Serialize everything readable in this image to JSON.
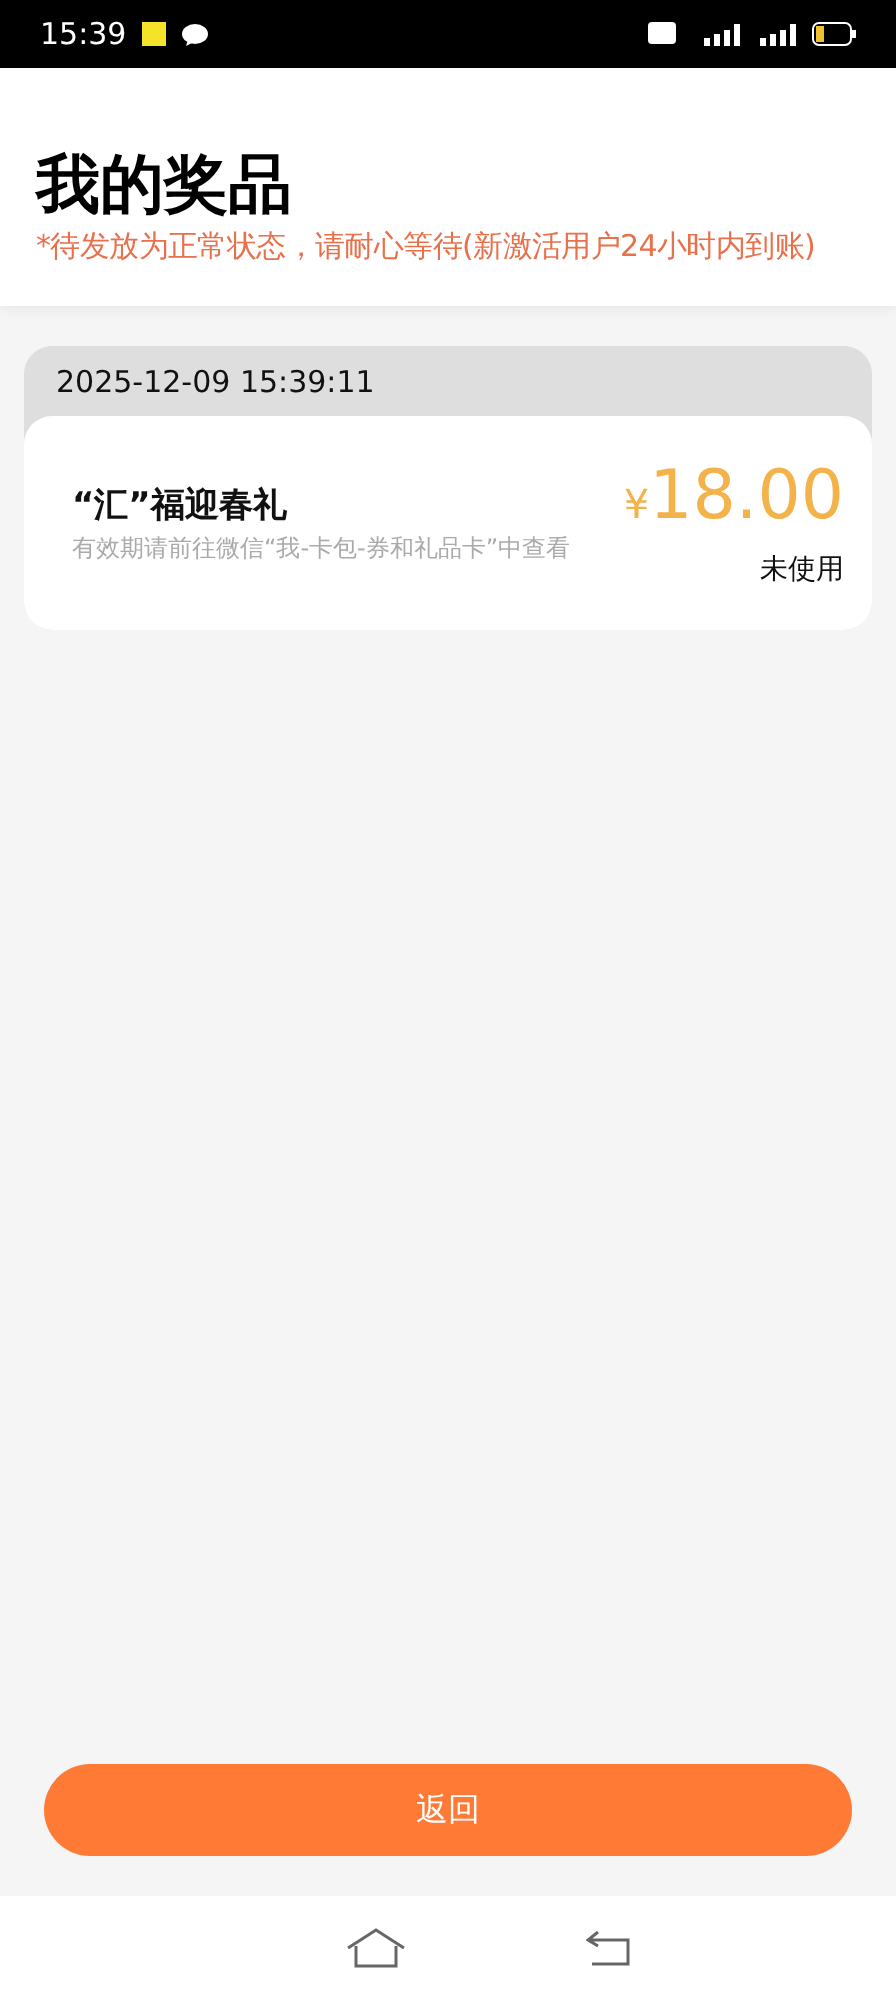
{
  "status_bar": {
    "time": "15:39"
  },
  "header": {
    "title": "我的奖品",
    "notice": "*待发放为正常状态，请耐心等待(新激活用户24小时内到账)"
  },
  "prizes": [
    {
      "date": "2025-12-09 15:39:11",
      "name": "“汇”福迎春礼",
      "hint": "有效期请前往微信“我-卡包-券和礼品卡”中查看",
      "currency": "¥",
      "amount": "18.00",
      "status": "未使用"
    }
  ],
  "back_button": {
    "label": "返回"
  }
}
